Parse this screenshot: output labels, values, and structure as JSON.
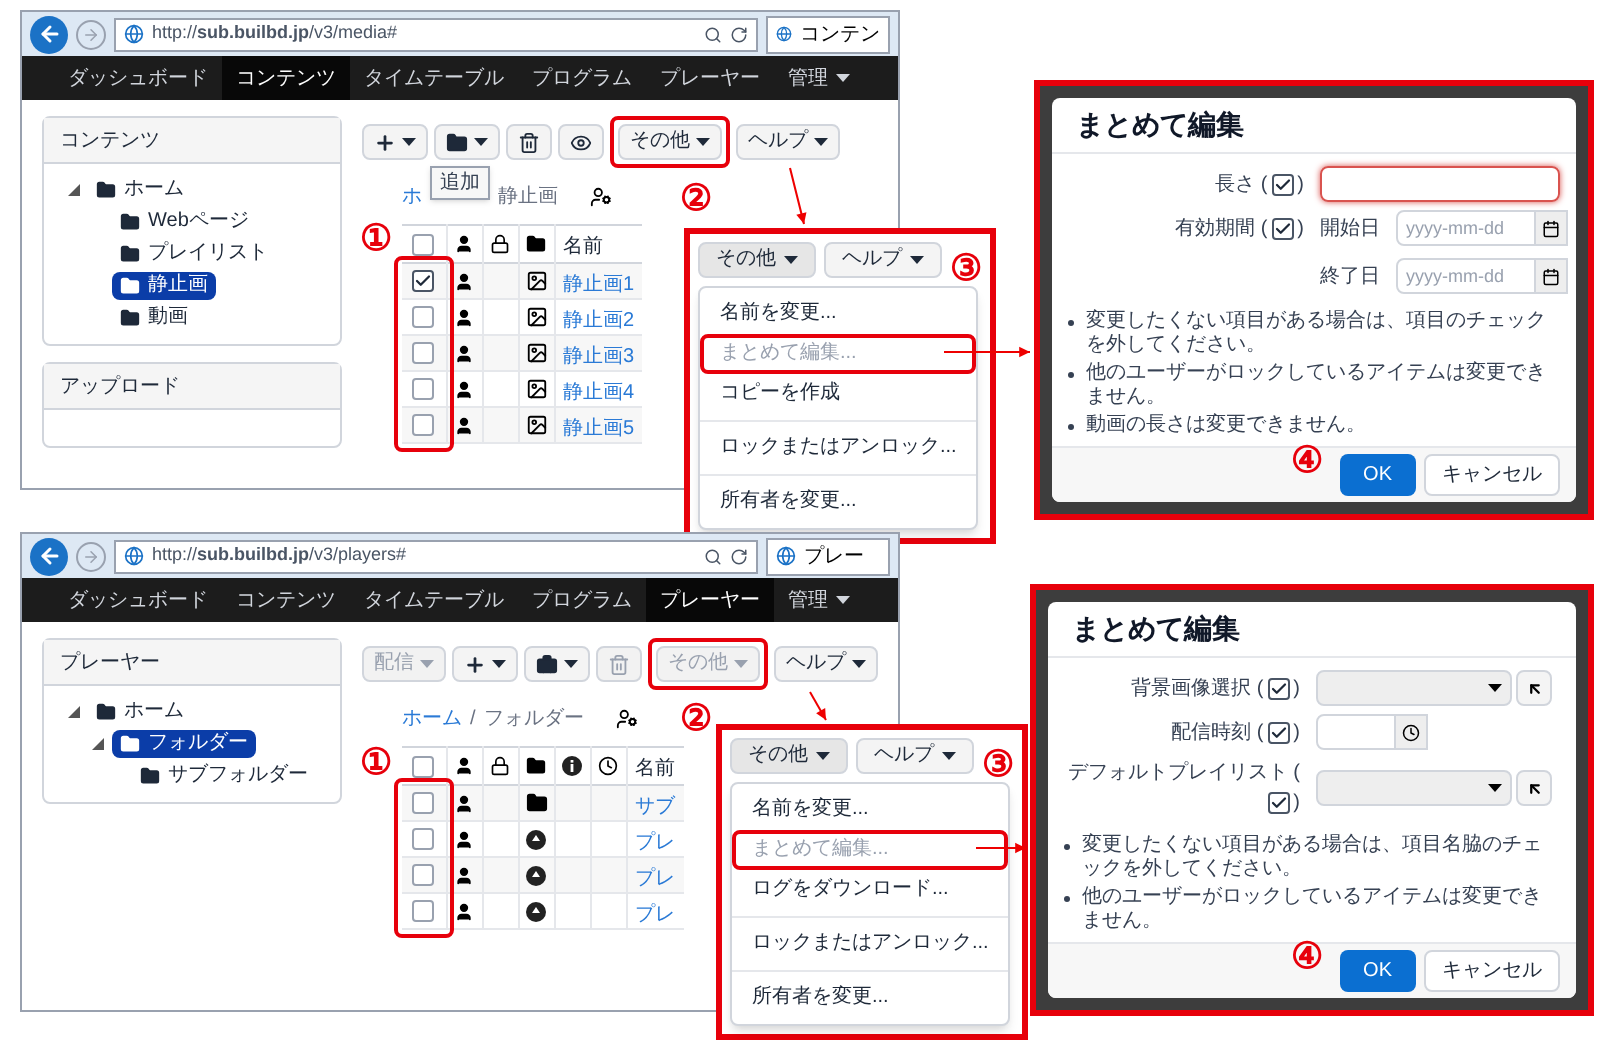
{
  "sections": [
    {
      "browser": {
        "url": "http://**sub.builbd.jp**/v3/media#",
        "tab_title": "コンテン",
        "nav": [
          {
            "label": "ダッシュボード",
            "selected": false,
            "dropdown": false
          },
          {
            "label": "コンテンツ",
            "selected": true,
            "dropdown": false
          },
          {
            "label": "タイムテーブル",
            "selected": false,
            "dropdown": false
          },
          {
            "label": "プログラム",
            "selected": false,
            "dropdown": false
          },
          {
            "label": "プレーヤー",
            "selected": false,
            "dropdown": false
          },
          {
            "label": "管理",
            "selected": false,
            "dropdown": true
          }
        ],
        "sidebar": [
          {
            "title": "コンテンツ",
            "tree": [
              {
                "label": "ホーム",
                "expanded": true,
                "selected": false,
                "children": [
                  {
                    "label": "Webページ",
                    "selected": false
                  },
                  {
                    "label": "プレイリスト",
                    "selected": false
                  },
                  {
                    "label": "静止画",
                    "selected": true
                  },
                  {
                    "label": "動画",
                    "selected": false
                  }
                ]
              }
            ]
          },
          {
            "title": "アップロード"
          }
        ],
        "toolbar": [
          {
            "kind": "add",
            "caret": true,
            "disabled": false,
            "highlighted": false
          },
          {
            "kind": "folder",
            "caret": true,
            "disabled": false,
            "highlighted": false
          },
          {
            "kind": "delete",
            "caret": false,
            "disabled": false,
            "highlighted": false
          },
          {
            "kind": "view",
            "caret": false,
            "disabled": false,
            "highlighted": false
          },
          {
            "kind": "text",
            "label": "その他",
            "caret": true,
            "disabled": false,
            "highlighted": true
          },
          {
            "kind": "text",
            "label": "ヘルプ",
            "caret": true,
            "disabled": false,
            "highlighted": false
          }
        ],
        "breadcrumb": [
          {
            "label": "ホ",
            "link": true
          },
          {
            "label": "静止画",
            "link": false
          }
        ],
        "tooltip": "追加",
        "columns": [
          {
            "kind": "checkbox",
            "checked": false
          },
          {
            "kind": "owner"
          },
          {
            "kind": "lock"
          },
          {
            "kind": "type"
          },
          {
            "kind": "name",
            "label": "名前"
          }
        ],
        "checkbox_column_highlighted": true,
        "rows": [
          {
            "checked": true,
            "kind": "image",
            "name": "静止画1"
          },
          {
            "checked": false,
            "kind": "image",
            "name": "静止画2"
          },
          {
            "checked": false,
            "kind": "image",
            "name": "静止画3"
          },
          {
            "checked": false,
            "kind": "image",
            "name": "静止画4"
          },
          {
            "checked": false,
            "kind": "image",
            "name": "静止画5"
          }
        ]
      },
      "menu": {
        "buttons": [
          {
            "label": "その他",
            "caret": true
          },
          {
            "label": "ヘルプ",
            "caret": true
          }
        ],
        "items": [
          {
            "kind": "item",
            "label": "名前を変更...",
            "disabled": false,
            "highlighted": false
          },
          {
            "kind": "item",
            "label": "まとめて編集...",
            "disabled": true,
            "highlighted": true
          },
          {
            "kind": "item",
            "label": "コピーを作成",
            "disabled": false,
            "highlighted": false
          },
          {
            "kind": "divider"
          },
          {
            "kind": "item",
            "label": "ロックまたはアンロック...",
            "disabled": false,
            "highlighted": false
          },
          {
            "kind": "divider"
          },
          {
            "kind": "item",
            "label": "所有者を変更...",
            "disabled": false,
            "highlighted": false
          }
        ]
      },
      "dialog": {
        "title": "まとめて編集",
        "fields": [
          {
            "kind": "text",
            "label": "長さ (",
            "suffix": ")",
            "checked": true,
            "focused": true
          },
          {
            "kind": "daterange",
            "label": "有効期間 (",
            "suffix": ")",
            "checked": true,
            "start_label": "開始日",
            "start_placeholder": "yyyy-mm-dd",
            "end_label": "終了日",
            "end_placeholder": "yyyy-mm-dd"
          }
        ],
        "notes": [
          "変更したくない項目がある場合は、項目のチェックを外してください。",
          "他のユーザーがロックしているアイテムは変更できません。",
          "動画の長さは変更できません。"
        ],
        "ok": "OK",
        "cancel": "キャンセル"
      },
      "markers": [
        "①",
        "②",
        "③",
        "④"
      ]
    },
    {
      "browser": {
        "url": "http://**sub.builbd.jp**/v3/players#",
        "tab_title": "プレー",
        "nav": [
          {
            "label": "ダッシュボード",
            "selected": false,
            "dropdown": false
          },
          {
            "label": "コンテンツ",
            "selected": false,
            "dropdown": false
          },
          {
            "label": "タイムテーブル",
            "selected": false,
            "dropdown": false
          },
          {
            "label": "プログラム",
            "selected": false,
            "dropdown": false
          },
          {
            "label": "プレーヤー",
            "selected": true,
            "dropdown": false
          },
          {
            "label": "管理",
            "selected": false,
            "dropdown": true
          }
        ],
        "sidebar": [
          {
            "title": "プレーヤー",
            "tree": [
              {
                "label": "ホーム",
                "expanded": true,
                "selected": false,
                "children": [
                  {
                    "label": "フォルダー",
                    "expanded": true,
                    "selected": true,
                    "children": [
                      {
                        "label": "サブフォルダー",
                        "selected": false
                      }
                    ]
                  }
                ]
              }
            ]
          }
        ],
        "toolbar": [
          {
            "kind": "text",
            "label": "配信",
            "caret": true,
            "disabled": true,
            "highlighted": false
          },
          {
            "kind": "add",
            "caret": true,
            "disabled": false,
            "highlighted": false
          },
          {
            "kind": "briefcase",
            "caret": true,
            "disabled": false,
            "highlighted": false
          },
          {
            "kind": "delete",
            "caret": false,
            "disabled": true,
            "highlighted": false
          },
          {
            "kind": "text",
            "label": "その他",
            "caret": true,
            "disabled": true,
            "highlighted": true
          },
          {
            "kind": "text",
            "label": "ヘルプ",
            "caret": true,
            "disabled": false,
            "highlighted": false
          }
        ],
        "breadcrumb": [
          {
            "label": "ホーム",
            "link": true
          },
          {
            "label": "/",
            "link": false
          },
          {
            "label": "フォルダー",
            "link": false
          }
        ],
        "columns": [
          {
            "kind": "checkbox",
            "checked": false
          },
          {
            "kind": "owner"
          },
          {
            "kind": "lock"
          },
          {
            "kind": "type"
          },
          {
            "kind": "info"
          },
          {
            "kind": "schedule"
          },
          {
            "kind": "name",
            "label": "名前"
          }
        ],
        "checkbox_column_highlighted": true,
        "rows": [
          {
            "checked": false,
            "kind": "folder",
            "name": "サブ"
          },
          {
            "checked": false,
            "kind": "player",
            "name": "プレ"
          },
          {
            "checked": false,
            "kind": "player",
            "name": "プレ"
          },
          {
            "checked": false,
            "kind": "player",
            "name": "プレ"
          }
        ]
      },
      "menu": {
        "buttons": [
          {
            "label": "その他",
            "caret": true
          },
          {
            "label": "ヘルプ",
            "caret": true
          }
        ],
        "items": [
          {
            "kind": "item",
            "label": "名前を変更...",
            "disabled": false,
            "highlighted": false
          },
          {
            "kind": "item",
            "label": "まとめて編集...",
            "disabled": true,
            "highlighted": true
          },
          {
            "kind": "item",
            "label": "ログをダウンロード...",
            "disabled": false,
            "highlighted": false
          },
          {
            "kind": "divider"
          },
          {
            "kind": "item",
            "label": "ロックまたはアンロック...",
            "disabled": false,
            "highlighted": false
          },
          {
            "kind": "divider"
          },
          {
            "kind": "item",
            "label": "所有者を変更...",
            "disabled": false,
            "highlighted": false
          }
        ]
      },
      "dialog": {
        "title": "まとめて編集",
        "fields": [
          {
            "kind": "select",
            "label": "背景画像選択 (",
            "suffix": ")",
            "checked": true
          },
          {
            "kind": "time",
            "label": "配信時刻 (",
            "suffix": ")",
            "checked": true
          },
          {
            "kind": "select",
            "label": "デフォルトプレイリスト (",
            "suffix": ")",
            "checked": true
          }
        ],
        "notes": [
          "変更したくない項目がある場合は、項目名脇のチェックを外してください。",
          "他のユーザーがロックしているアイテムは変更できません。"
        ],
        "ok": "OK",
        "cancel": "キャンセル"
      },
      "markers": [
        "①",
        "②",
        "③",
        "④"
      ]
    }
  ]
}
